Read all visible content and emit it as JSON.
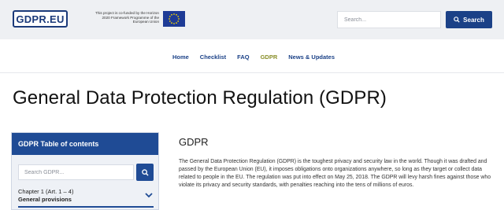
{
  "header": {
    "logo_text": "GDPR.EU",
    "eu_notice": "This project is co-funded by the Horizon 2020 Framework Programme of the European Union",
    "search_placeholder": "Search...",
    "search_button": "Search"
  },
  "nav": {
    "items": [
      {
        "label": "Home"
      },
      {
        "label": "Checklist"
      },
      {
        "label": "FAQ"
      },
      {
        "label": "GDPR",
        "active": true
      },
      {
        "label": "News & Updates"
      }
    ],
    "active_color": "#8a8f2a"
  },
  "page": {
    "title": "General Data Protection Regulation (GDPR)"
  },
  "sidebar": {
    "header": "GDPR Table of contents",
    "search_placeholder": "Search GDPR...",
    "chapter": {
      "number": "Chapter 1 (Art. 1 – 4)",
      "title": "General provisions"
    }
  },
  "main": {
    "heading": "GDPR",
    "paragraph": "The General Data Protection Regulation (GDPR) is the toughest privacy and security law in the world. Though it was drafted and passed by the European Union (EU), it imposes obligations onto organizations anywhere, so long as they target or collect data related to people in the EU. The regulation was put into effect on May 25, 2018. The GDPR will levy harsh fines against those who violate its privacy and security standards, with penalties reaching into the tens of millions of euros."
  },
  "colors": {
    "brand_blue": "#1b4187",
    "header_bg": "#eef0f3",
    "toc_header": "#1f4b95"
  }
}
